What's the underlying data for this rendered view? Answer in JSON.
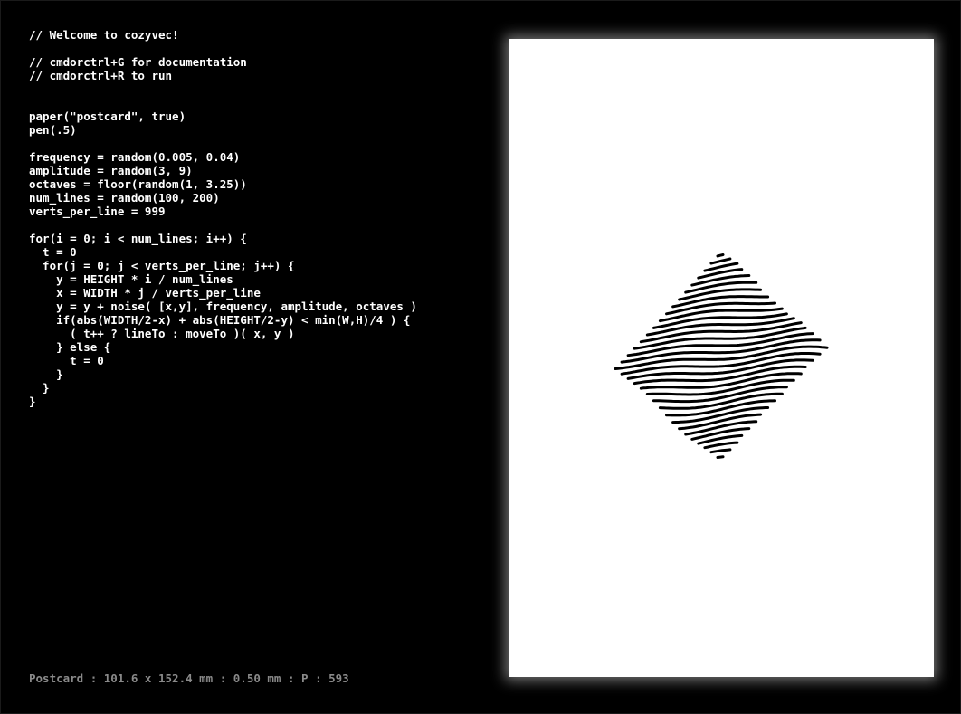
{
  "editor": {
    "code": "// Welcome to cozyvec!\n\n// cmdorctrl+G for documentation\n// cmdorctrl+R to run\n\n\npaper(\"postcard\", true)\npen(.5)\n\nfrequency = random(0.005, 0.04)\namplitude = random(3, 9)\noctaves = floor(random(1, 3.25))\nnum_lines = random(100, 200)\nverts_per_line = 999\n\nfor(i = 0; i < num_lines; i++) {\n  t = 0\n  for(j = 0; j < verts_per_line; j++) {\n    y = HEIGHT * i / num_lines\n    x = WIDTH * j / verts_per_line\n    y = y + noise( [x,y], frequency, amplitude, octaves )\n    if(abs(WIDTH/2-x) + abs(HEIGHT/2-y) < min(W,H)/4 ) {\n      ( t++ ? lineTo : moveTo )( x, y )\n    } else {\n      t = 0\n    }\n  }\n}"
  },
  "status_bar": {
    "text": "Postcard : 101.6 x 152.4 mm : 0.50 mm : P : 593"
  },
  "paper": {
    "background": "#ffffff",
    "ink_color": "#000000",
    "shape": "diamond",
    "stroke_count": 33
  }
}
